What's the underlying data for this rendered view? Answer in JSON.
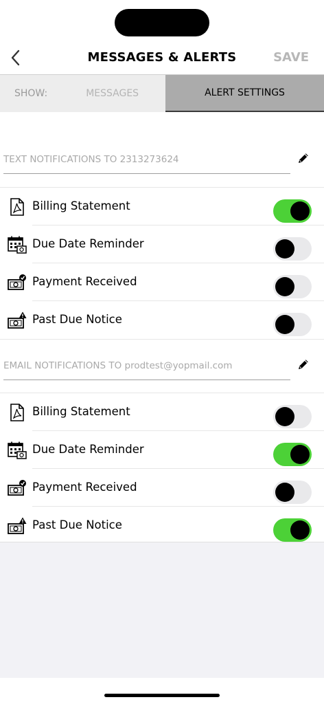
{
  "header": {
    "title": "MESSAGES & ALERTS",
    "save_label": "SAVE",
    "back_icon": "chevron-left-icon"
  },
  "tabs": {
    "show_label": "SHOW:",
    "messages": "MESSAGES",
    "alert_settings": "ALERT SETTINGS",
    "active": "alert_settings"
  },
  "text_section": {
    "field": "TEXT NOTIFICATIONS TO 2313273624",
    "edit_icon": "pencil-icon",
    "items": [
      {
        "label": "Billing Statement",
        "icon": "pdf-document-icon",
        "enabled": true
      },
      {
        "label": "Due Date Reminder",
        "icon": "calendar-money-icon",
        "enabled": false
      },
      {
        "label": "Payment Received",
        "icon": "money-check-icon",
        "enabled": false
      },
      {
        "label": "Past Due Notice",
        "icon": "money-warning-icon",
        "enabled": false
      }
    ]
  },
  "email_section": {
    "field": "EMAIL NOTIFICATIONS TO prodtest@yopmail.com",
    "edit_icon": "pencil-icon",
    "items": [
      {
        "label": "Billing Statement",
        "icon": "pdf-document-icon",
        "enabled": false
      },
      {
        "label": "Due Date Reminder",
        "icon": "calendar-money-icon",
        "enabled": true
      },
      {
        "label": "Payment Received",
        "icon": "money-check-icon",
        "enabled": false
      },
      {
        "label": "Past Due Notice",
        "icon": "money-warning-icon",
        "enabled": true
      }
    ]
  },
  "colors": {
    "toggle_on": "#4cd137",
    "toggle_off": "#e9e9eb",
    "tab_active_bg": "#ababab",
    "tab_inactive_bg": "#ededed",
    "save_disabled": "#b7b7b7"
  }
}
